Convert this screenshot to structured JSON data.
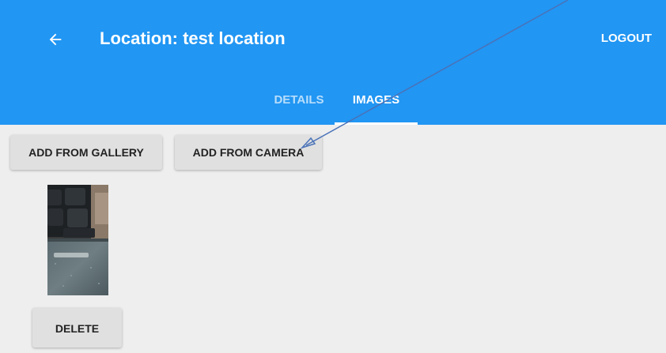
{
  "header": {
    "back_icon": "arrow-left-icon",
    "title": "Location: test location",
    "logout_label": "LOGOUT",
    "background_color": "#2196f3"
  },
  "tabs": [
    {
      "label": "DETAILS",
      "selected": false
    },
    {
      "label": "IMAGES",
      "selected": true
    }
  ],
  "actions": {
    "add_from_gallery_label": "ADD FROM GALLERY",
    "add_from_camera_label": "ADD FROM CAMERA"
  },
  "images": [
    {
      "thumbnail_icon": "photo-thumbnail",
      "delete_label": "DELETE"
    }
  ],
  "colors": {
    "content_background": "#eeeeee",
    "button_background": "#e0e0e0",
    "annotation_arrow": "#4a72b8"
  }
}
